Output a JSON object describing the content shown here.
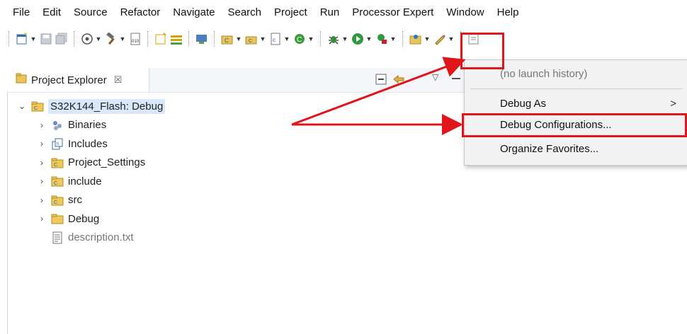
{
  "menubar": {
    "items": [
      "File",
      "Edit",
      "Source",
      "Refactor",
      "Navigate",
      "Search",
      "Project",
      "Run",
      "Processor Expert",
      "Window",
      "Help"
    ]
  },
  "toolbar": {
    "icons": [
      "new-icon",
      "save-icon",
      "save-all-icon",
      "build-target-icon",
      "build-icon",
      "binary-icon",
      "new-class-icon",
      "new-file-icon",
      "new-folder-icon",
      "new-project-icon",
      "new-source-icon",
      "new-header-icon",
      "class-wizard-icon",
      "debug-icon",
      "run-icon",
      "external-tools-icon",
      "open-perspective-icon",
      "pencil-icon",
      "search-icon"
    ]
  },
  "project_explorer": {
    "tab_title": "Project Explorer",
    "close_glyph": "☒",
    "root": "S32K144_Flash: Debug",
    "children": [
      {
        "label": "Binaries"
      },
      {
        "label": "Includes"
      },
      {
        "label": "Project_Settings"
      },
      {
        "label": "include"
      },
      {
        "label": "src"
      },
      {
        "label": "Debug"
      },
      {
        "label": "description.txt"
      }
    ]
  },
  "debug_menu": {
    "items": [
      {
        "label": "(no launch history)"
      },
      {
        "label": "Debug As",
        "submenu_arrow": ">"
      },
      {
        "label": "Debug Configurations..."
      },
      {
        "label": "Organize Favorites..."
      }
    ]
  },
  "colors": {
    "highlight": "#e0161b",
    "selection": "#d9e8fb"
  }
}
